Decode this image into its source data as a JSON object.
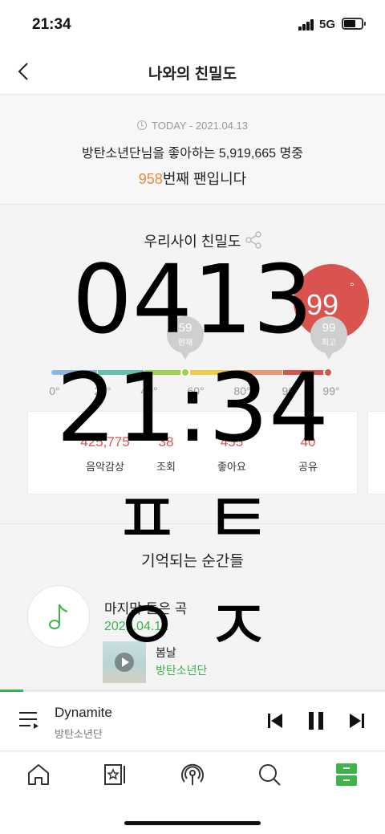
{
  "status_bar": {
    "time": "21:34",
    "network": "5G"
  },
  "header": {
    "title": "나와의 친밀도"
  },
  "today": {
    "date_line": "TODAY - 2021.04.13",
    "fan_line": "방탄소년단님을 좋아하는 5,919,665 명중",
    "rank_number": "958",
    "rank_suffix": "번째 팬입니다"
  },
  "affinity": {
    "title": "우리사이 친밀도",
    "score": "99",
    "score_unit": "°",
    "my_pin": {
      "value": "59",
      "label": "현재"
    },
    "max_pin": {
      "value": "99",
      "label": "최고"
    },
    "my_level": 59,
    "scale_colors": [
      "#8cb4e8",
      "#5ec4b0",
      "#9fd24a",
      "#eecb48",
      "#ec9a72",
      "#d9534f"
    ],
    "ticks": [
      "0°",
      "20°",
      "40°",
      "60°",
      "80°",
      "90°",
      "99°"
    ]
  },
  "stats": [
    {
      "value": "425,775",
      "label": "음악감상"
    },
    {
      "value": "38",
      "label": "조회"
    },
    {
      "value": "455",
      "label": "좋아요"
    },
    {
      "value": "40",
      "label": "공유"
    }
  ],
  "memory": {
    "title": "기억되는 순간들",
    "last_song_label": "마지막 들은 곡",
    "last_song_date": "2021.04.12",
    "song_title": "봄날",
    "song_artist": "방탄소년단"
  },
  "overlay": {
    "date": "0413",
    "time": "21:34",
    "char1": "ㅍ ㅌ",
    "char2": "ㅇ ㅈ"
  },
  "now_playing": {
    "title": "Dynamite",
    "artist": "방탄소년단",
    "progress": 0.06
  },
  "tabs": [
    "home-icon",
    "music-library-icon",
    "podcast-icon",
    "search-icon",
    "my-page-icon"
  ],
  "colors": {
    "accent_green": "#3cb44b",
    "score_red": "#d9534f",
    "rank_orange": "#e88b3a"
  }
}
